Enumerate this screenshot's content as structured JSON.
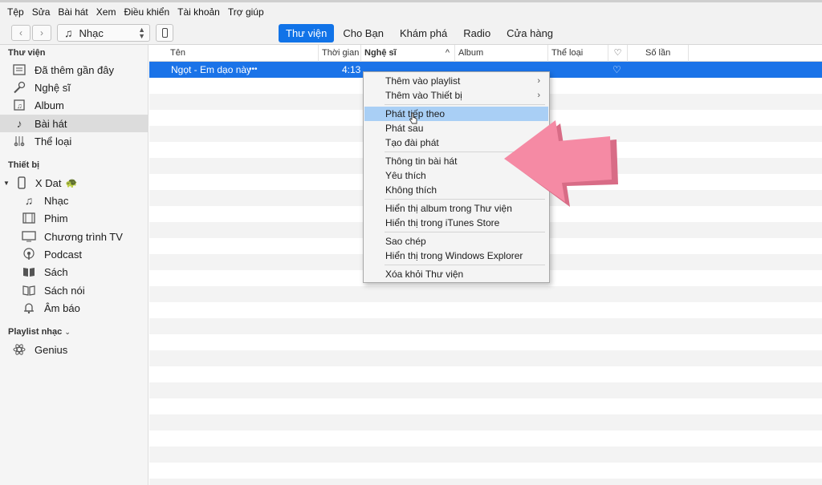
{
  "menubar": [
    "Tệp",
    "Sửa",
    "Bài hát",
    "Xem",
    "Điều khiển",
    "Tài khoản",
    "Trợ giúp"
  ],
  "toolbar": {
    "back_icon": "chevron-left-icon",
    "forward_icon": "chevron-right-icon",
    "media_label": "Nhạc",
    "tabs": [
      "Thư viện",
      "Cho Bạn",
      "Khám phá",
      "Radio",
      "Cửa hàng"
    ],
    "active_tab": 0,
    "accent": "#1173e8"
  },
  "sidebar": {
    "library_heading": "Thư viện",
    "library_items": [
      {
        "label": "Đã thêm gần đây",
        "icon": "recent-icon"
      },
      {
        "label": "Nghệ sĩ",
        "icon": "microphone-icon"
      },
      {
        "label": "Album",
        "icon": "album-icon"
      },
      {
        "label": "Bài hát",
        "icon": "music-note-icon"
      },
      {
        "label": "Thể loại",
        "icon": "genre-icon"
      }
    ],
    "devices_heading": "Thiết bị",
    "device_name": "X Dat",
    "device_items": [
      {
        "label": "Nhạc",
        "icon": "music-note-icon"
      },
      {
        "label": "Phim",
        "icon": "film-icon"
      },
      {
        "label": "Chương trình TV",
        "icon": "tv-icon"
      },
      {
        "label": "Podcast",
        "icon": "podcast-icon"
      },
      {
        "label": "Sách",
        "icon": "book-icon"
      },
      {
        "label": "Sách nói",
        "icon": "audiobook-icon"
      },
      {
        "label": "Âm báo",
        "icon": "bell-icon"
      }
    ],
    "playlist_heading": "Playlist nhạc",
    "playlist_items": [
      {
        "label": "Genius",
        "icon": "genius-atom-icon"
      }
    ]
  },
  "table": {
    "columns": [
      "Tên",
      "Thời gian",
      "Nghệ sĩ",
      "Album",
      "Thể loại",
      "♡",
      "Số lần phát"
    ],
    "sort_indicator": "^",
    "rows": [
      {
        "name": "Ngọt - Em dạo này",
        "more": "•••",
        "time": "4:13",
        "artist": "",
        "album": "",
        "genre": "",
        "love": "♡",
        "plays": ""
      }
    ]
  },
  "context_menu": {
    "items": [
      {
        "label": "Thêm vào playlist",
        "submenu": "›"
      },
      {
        "label": "Thêm vào Thiết bị",
        "submenu": "›"
      },
      {
        "label": "Phát tiếp theo"
      },
      {
        "label": "Phát sau"
      },
      {
        "label": "Tạo đài phát"
      },
      {
        "label": "Thông tin bài hát"
      },
      {
        "label": "Yêu thích"
      },
      {
        "label": "Không thích"
      },
      {
        "label": "Hiển thị album trong Thư viện"
      },
      {
        "label": "Hiển thị trong iTunes Store"
      },
      {
        "label": "Sao chép"
      },
      {
        "label": "Hiển thị trong Windows Explorer"
      },
      {
        "label": "Xóa khỏi Thư viện"
      }
    ],
    "highlighted_index": 2,
    "highlight_color": "#a9cff5",
    "arrow_color": "#f58aa4"
  }
}
